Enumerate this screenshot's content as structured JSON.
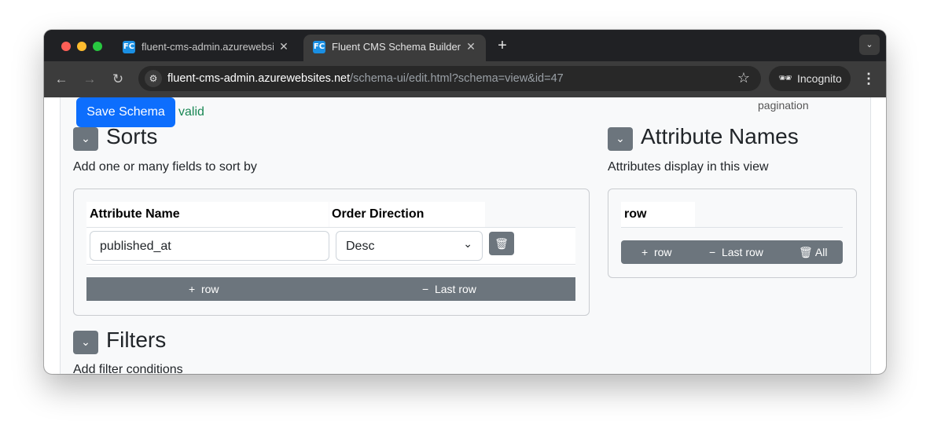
{
  "browser": {
    "tabs": [
      {
        "title": "fluent-cms-admin.azurewebsites.net",
        "icon": "fluent-cms-favicon",
        "active": false
      },
      {
        "title": "Fluent CMS Schema Builder",
        "icon": "fluent-cms-favicon",
        "active": true
      }
    ],
    "favicon_text": "FC",
    "url_host": "fluent-cms-admin.azurewebsites.net",
    "url_path": "/schema-ui/edit.html?schema=view&id=47",
    "incognito_label": "Incognito"
  },
  "page": {
    "pagination_label": "pagination",
    "save_button": "Save Schema",
    "status": "valid",
    "sorts": {
      "title": "Sorts",
      "description": "Add one or many fields to sort by",
      "columns": [
        "Attribute Name",
        "Order Direction"
      ],
      "rows": [
        {
          "attribute": "published_at",
          "direction": "Desc"
        }
      ],
      "add_row": "row",
      "remove_last_row": "Last row"
    },
    "attribute_names": {
      "title": "Attribute Names",
      "description": "Attributes display in this view",
      "column": "row",
      "add_row": "row",
      "remove_last_row": "Last row",
      "remove_all": "All"
    },
    "filters": {
      "title": "Filters",
      "description": "Add filter conditions"
    }
  },
  "colors": {
    "primary": "#0d6efd",
    "secondary": "#6c757d",
    "valid": "#198754"
  }
}
